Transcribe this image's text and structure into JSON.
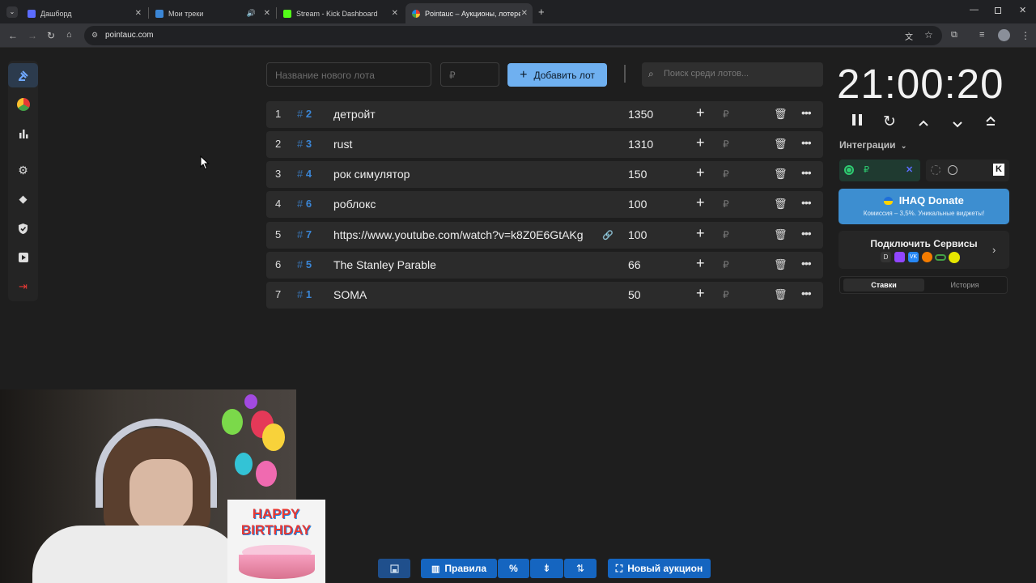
{
  "browser": {
    "tabs": [
      {
        "label": "Дашборд",
        "fav_color": "#5b6cff"
      },
      {
        "label": "Мои треки",
        "fav_color": "#3b86d6"
      },
      {
        "label": "Stream - Kick Dashboard",
        "fav_color": "#53fc18"
      },
      {
        "label": "Pointauc – Аукционы, лотереи",
        "fav_color": "#e6a23c"
      }
    ],
    "url": "pointauc.com"
  },
  "form": {
    "lot_name_placeholder": "Название нового лота",
    "amount_placeholder": "₽",
    "add_button": "Добавить лот",
    "search_placeholder": "Поиск среди лотов..."
  },
  "lots": [
    {
      "num": "1",
      "id": "2",
      "name": "детройт",
      "amount": "1350",
      "link": false
    },
    {
      "num": "2",
      "id": "3",
      "name": "rust",
      "amount": "1310",
      "link": false
    },
    {
      "num": "3",
      "id": "4",
      "name": "рок симулятор",
      "amount": "150",
      "link": false
    },
    {
      "num": "4",
      "id": "6",
      "name": "роблокс",
      "amount": "100",
      "link": false
    },
    {
      "num": "5",
      "id": "7",
      "name": "https://www.youtube.com/watch?v=k8Z0E6GtAKg",
      "amount": "100",
      "link": true
    },
    {
      "num": "6",
      "id": "5",
      "name": "The Stanley Parable",
      "amount": "66",
      "link": false
    },
    {
      "num": "7",
      "id": "1",
      "name": "SOMA",
      "amount": "50",
      "link": false
    }
  ],
  "lot_currency": "₽",
  "timer": "21:00:20",
  "integrations": {
    "title": "Интеграции",
    "currency": "₽"
  },
  "donate": {
    "title": "IHAQ Donate",
    "subtitle": "Комиссия – 3,5%. Уникальные виджеты!"
  },
  "connect": {
    "title": "Подключить Сервисы"
  },
  "history_tabs": [
    "Ставки",
    "История"
  ],
  "overlay": {
    "cake_text": "HAPPY BIRTHDAY"
  },
  "bottom": {
    "rules": "Правила",
    "new_auction": "Новый аукцион"
  },
  "colors": {
    "accent": "#6fb0f0",
    "link_blue": "#3b86d6",
    "toolbar_blue": "#1565c0",
    "logout_red": "#e53935"
  }
}
